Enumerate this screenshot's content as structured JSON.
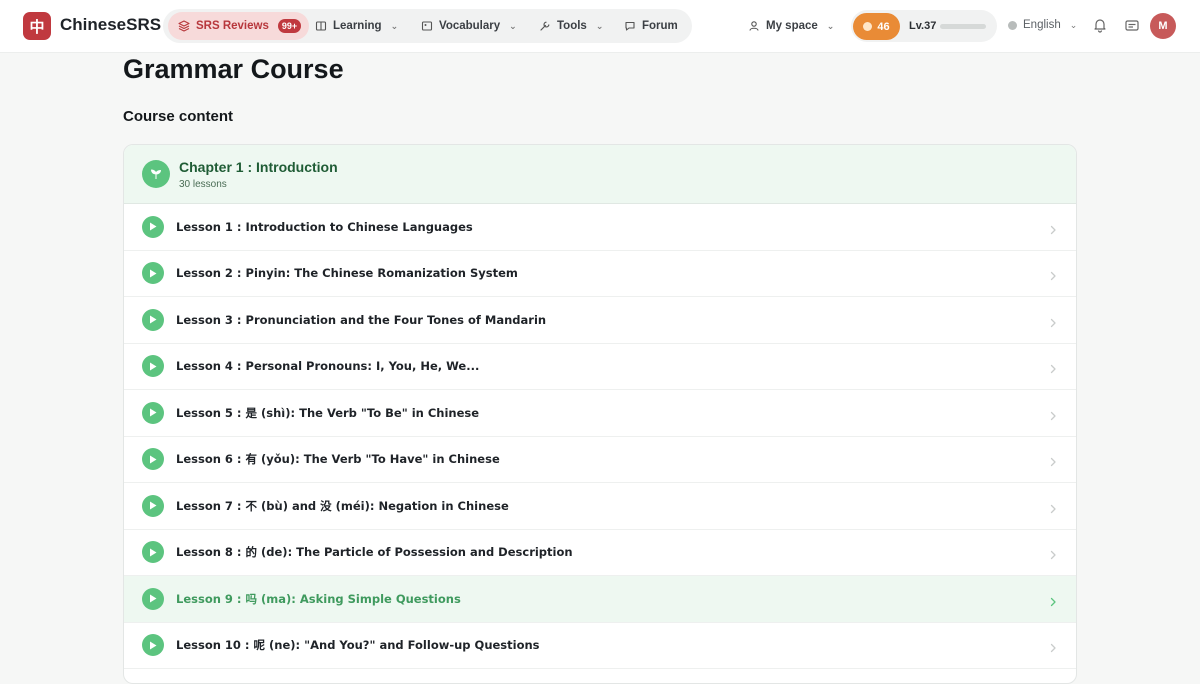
{
  "header": {
    "logo_char": "中",
    "app_name": "ChineseSRS",
    "nav": {
      "srs_label": "SRS Reviews",
      "srs_badge": "99+",
      "learning_label": "Learning",
      "vocabulary_label": "Vocabulary",
      "tools_label": "Tools",
      "forum_label": "Forum"
    },
    "my_space_label": "My space",
    "streak_count": "46",
    "level_label": "Lv.37",
    "level_progress": 0.0,
    "language_label": "English",
    "avatar_initial": "M"
  },
  "page": {
    "title": "Grammar Course",
    "section_title": "Course content"
  },
  "chapter": {
    "title": "Chapter 1 : Introduction",
    "subtitle": "30 lessons",
    "lessons": [
      {
        "label": "Lesson 1 : Introduction to Chinese Languages"
      },
      {
        "label": "Lesson 2 : Pinyin: The Chinese Romanization System"
      },
      {
        "label": "Lesson 3 : Pronunciation and the Four Tones of Mandarin"
      },
      {
        "label": "Lesson 4 : Personal Pronouns: I, You, He, We..."
      },
      {
        "label": "Lesson 5 : 是 (shì): The Verb \"To Be\" in Chinese"
      },
      {
        "label": "Lesson 6 : 有 (yǒu): The Verb \"To Have\" in Chinese"
      },
      {
        "label": "Lesson 7 : 不 (bù) and 没 (méi): Negation in Chinese"
      },
      {
        "label": "Lesson 8 : 的 (de): The Particle of Possession and Description"
      },
      {
        "label": "Lesson 9 : 吗 (ma): Asking Simple Questions"
      },
      {
        "label": "Lesson 10 : 呢 (ne): \"And You?\" and Follow-up Questions"
      }
    ],
    "active_index": 8
  },
  "colors": {
    "brand_red": "#c0393f",
    "accent_green": "#5cc47f",
    "streak_orange": "#e98b36"
  },
  "icons": {
    "srs": "stack-icon",
    "learning": "book-icon",
    "vocabulary": "image-icon",
    "tools": "wrench-icon",
    "forum": "chat-icon",
    "my_space": "user-icon",
    "streak": "flame-icon",
    "language": "globe-icon",
    "notifications": "bell-icon",
    "cards": "cards-icon",
    "chapter": "sprout-icon",
    "lesson": "play-icon",
    "row": "chevron-right-icon"
  }
}
